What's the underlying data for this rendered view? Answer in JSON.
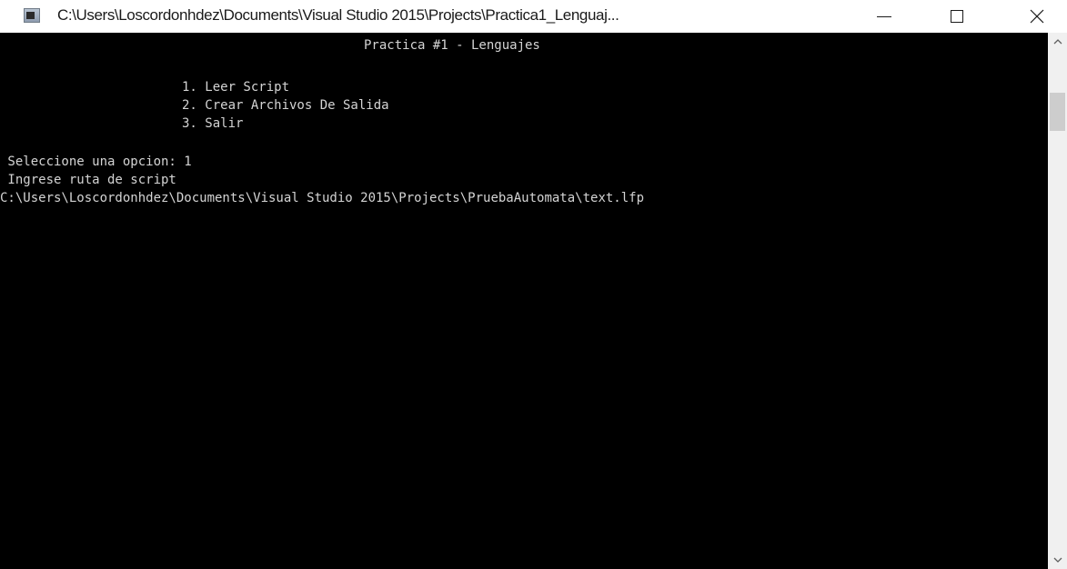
{
  "window": {
    "title": "C:\\Users\\Loscordonhdez\\Documents\\Visual Studio 2015\\Projects\\Practica1_Lenguaj...",
    "icon": "console-app-icon",
    "controls": {
      "minimize": "minimize-icon",
      "maximize": "maximize-icon",
      "close": "close-icon"
    }
  },
  "console": {
    "background": "#000000",
    "text_color": "#d4d4d4",
    "lines": {
      "header": "Practica #1 - Lenguajes",
      "option_1": "1. Leer Script",
      "option_2": "2. Crear Archivos De Salida",
      "option_3": "3. Salir",
      "prompt": " Seleccione una opcion: 1",
      "path_prompt": " Ingrese ruta de script",
      "path_input": "C:\\Users\\Loscordonhdez\\Documents\\Visual Studio 2015\\Projects\\PruebaAutomata\\text.lfp"
    }
  },
  "scrollbar": {
    "up_icon": "chevron-up-icon",
    "down_icon": "chevron-down-icon"
  }
}
